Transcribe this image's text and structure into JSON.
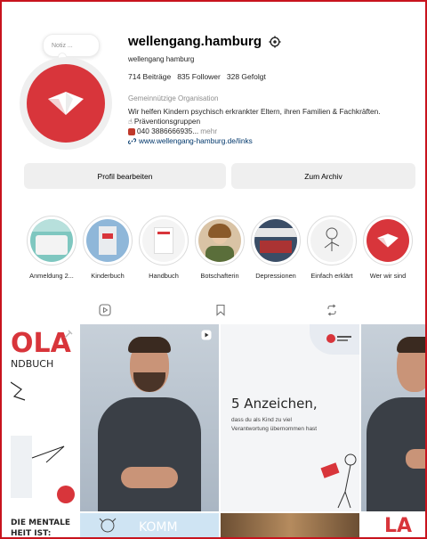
{
  "profile": {
    "note": "Notiz ...",
    "username": "wellengang.hamburg",
    "full_name": "wellengang hamburg",
    "stats": {
      "posts": "714 Beiträge",
      "followers": "835 Follower",
      "following": "328 Gefolgt"
    },
    "category": "Gemeinnützige Organisation",
    "bio_line1": "Wir helfen Kindern psychisch erkrankter Eltern, ihren Familien & Fachkräften.",
    "bio_line2": "Präventionsgruppen",
    "bio_line3": "040 3886666935...",
    "bio_more": "mehr",
    "link": "www.wellengang-hamburg.de/links"
  },
  "buttons": {
    "edit": "Profil bearbeiten",
    "archive": "Zum Archiv"
  },
  "highlights": [
    {
      "label": "Anmeldung 2..."
    },
    {
      "label": "Kinderbuch"
    },
    {
      "label": "Handbuch"
    },
    {
      "label": "Botschafterin"
    },
    {
      "label": "Depressionen"
    },
    {
      "label": "Einfach erklärt"
    },
    {
      "label": "Wer wir sind"
    }
  ],
  "tabs": [
    {
      "icon": "reels-icon"
    },
    {
      "icon": "saved-icon"
    },
    {
      "icon": "tagged-icon"
    }
  ],
  "grid": {
    "tile1_title": "OLA",
    "tile1_sub": "NDBUCH",
    "tile3_heading": "5 Anzeichen,",
    "tile3_text1": "dass du als Kind zu viel",
    "tile3_text2": "Verantwortung übernommen hast",
    "bottom1_line1": "DIE MENTALE",
    "bottom1_line2": "HEIT IST:",
    "bottom2_text": "KOMM",
    "bottom4_text": "LA"
  },
  "colors": {
    "brand_red": "#d8353b",
    "link_blue": "#00376b",
    "button_gray": "#efefef"
  }
}
